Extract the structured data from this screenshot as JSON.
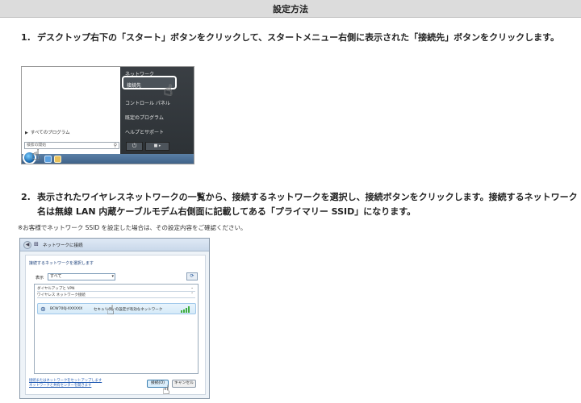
{
  "header": {
    "title": "設定方法"
  },
  "steps": [
    {
      "num": "1.",
      "text": "デスクトップ右下の「スタート」ボタンをクリックして、スタートメニュー右側に表示された「接続先」ボタンをクリックします。"
    },
    {
      "num": "2.",
      "text": "表示されたワイヤレスネットワークの一覧から、接続するネットワークを選択し、接続ボタンをクリックします。接続するネットワーク名は無線 LAN 内蔵ケーブルモデム右側面に記載してある「プライマリー SSID」になります。"
    }
  ],
  "note": "※お客様でネットワーク SSID を設定した場合は、その設定内容をご確認ください。",
  "screenshot1": {
    "menu_items": [
      "ネットワーク",
      "接続先",
      "コントロール パネル",
      "既定のプログラム",
      "ヘルプとサポート"
    ],
    "all_programs": "すべてのプログラム",
    "search_placeholder": "検索の開始"
  },
  "screenshot2": {
    "window_title": "ネットワークに接続",
    "select_prompt": "接続するネットワークを選択します",
    "show_label": "表示",
    "show_value": "すべて",
    "groups": [
      "ダイヤルアップと VPN",
      "ワイヤレス ネットワーク接続"
    ],
    "network": {
      "ssid": "BCW700J-XXXXXX",
      "security": "セキュリティの設定が有効なネットワーク"
    },
    "links": [
      "接続またはネットワークをセットアップします",
      "ネットワークと共有センターを開きます"
    ],
    "connect_button": "接続(O)",
    "cancel_button": "キャンセル"
  },
  "colors": {
    "header_bg": "#dcdcdc",
    "menu_dark": "#2d3236",
    "link_blue": "#1a55b0",
    "signal_green": "#3fae3f"
  }
}
